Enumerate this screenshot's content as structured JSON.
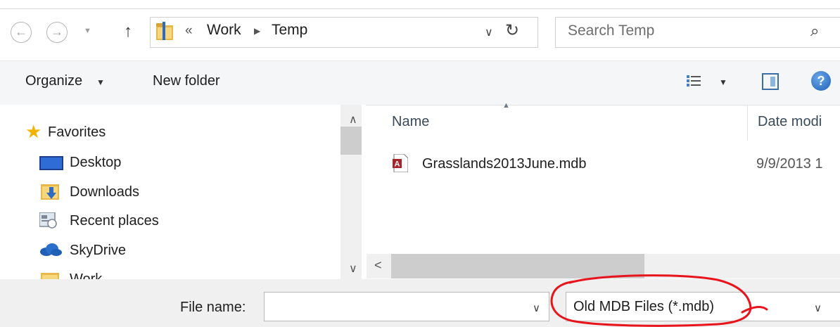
{
  "address": {
    "crumb_overflow": "«",
    "crumbs": [
      "Work",
      "Temp"
    ]
  },
  "search": {
    "placeholder": "Search Temp"
  },
  "toolbar": {
    "organize_label": "Organize",
    "new_folder_label": "New folder"
  },
  "nav_pane": {
    "favorites_label": "Favorites",
    "items": [
      {
        "label": "Desktop",
        "icon": "desktop-icon"
      },
      {
        "label": "Downloads",
        "icon": "downloads-folder-icon"
      },
      {
        "label": "Recent places",
        "icon": "recent-places-icon"
      },
      {
        "label": "SkyDrive",
        "icon": "skydrive-cloud-icon"
      },
      {
        "label": "Work",
        "icon": "folder-icon"
      }
    ]
  },
  "file_list": {
    "columns": [
      "Name",
      "Date modi"
    ],
    "files": [
      {
        "name": "Grasslands2013June.mdb",
        "date": "9/9/2013 1",
        "icon": "access-database-icon"
      }
    ]
  },
  "footer": {
    "file_name_label": "File name:",
    "file_name_value": "",
    "file_type_value": "Old MDB Files (*.mdb)"
  },
  "colors": {
    "toolbar_bg": "#f5f6f7",
    "footer_bg": "#f0f0f0",
    "annotation": "#e8141b"
  }
}
